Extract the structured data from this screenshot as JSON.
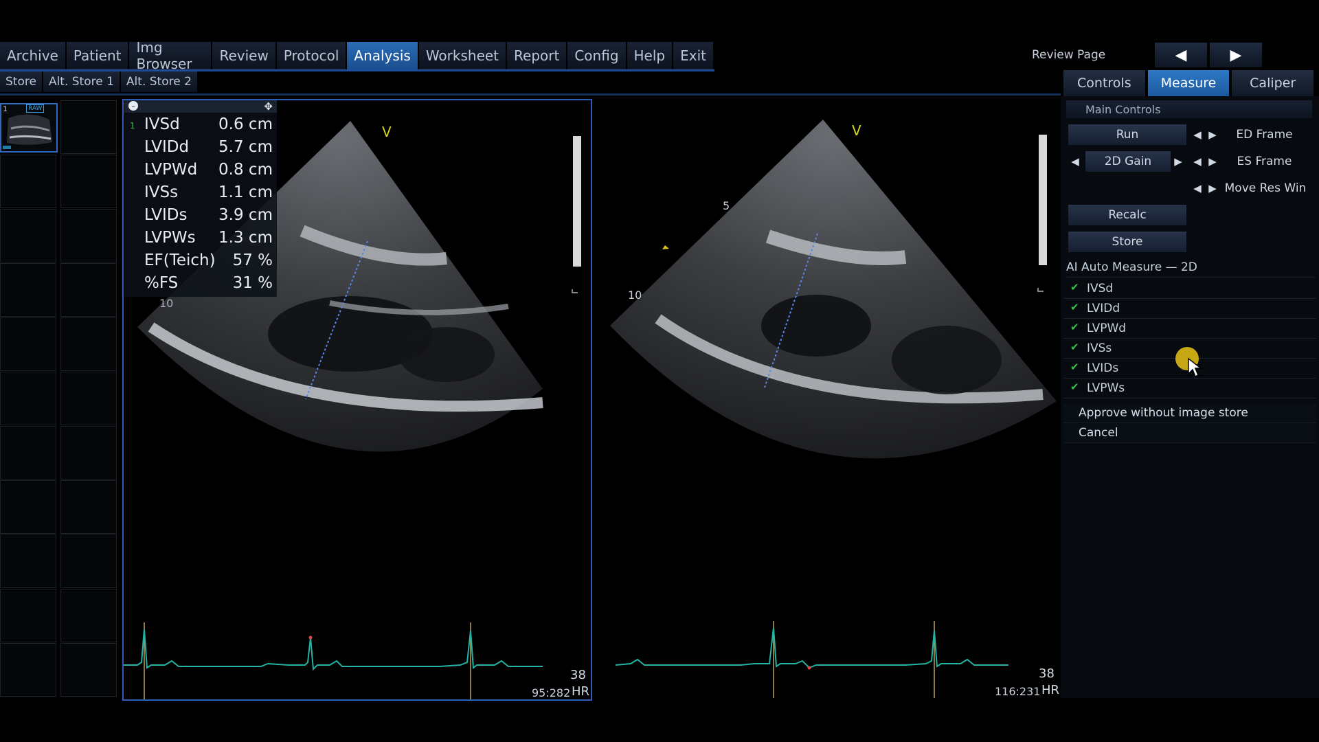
{
  "menu": {
    "items": [
      {
        "label": "Archive"
      },
      {
        "label": "Patient"
      },
      {
        "label": "Img Browser"
      },
      {
        "label": "Review"
      },
      {
        "label": "Protocol"
      },
      {
        "label": "Analysis"
      },
      {
        "label": "Worksheet"
      },
      {
        "label": "Report"
      },
      {
        "label": "Config"
      },
      {
        "label": "Help"
      },
      {
        "label": "Exit"
      }
    ],
    "active_index": 5
  },
  "review_page": {
    "label": "Review Page",
    "prev_icon": "triangle-left-icon",
    "next_icon": "triangle-right-icon"
  },
  "store_bar": {
    "items": [
      {
        "label": "Store"
      },
      {
        "label": "Alt. Store 1"
      },
      {
        "label": "Alt. Store 2"
      }
    ]
  },
  "tabs": {
    "items": [
      {
        "label": "Controls"
      },
      {
        "label": "Measure"
      },
      {
        "label": "Caliper"
      }
    ],
    "active_index": 1
  },
  "thumbnail": {
    "index_label": "1",
    "badge": "RAW"
  },
  "measurements": {
    "index": "1",
    "rows": [
      {
        "name": "IVSd",
        "value": "0.6 cm"
      },
      {
        "name": "LVIDd",
        "value": "5.7 cm"
      },
      {
        "name": "LVPWd",
        "value": "0.8 cm"
      },
      {
        "name": "IVSs",
        "value": "1.1 cm"
      },
      {
        "name": "LVIDs",
        "value": "3.9 cm"
      },
      {
        "name": "LVPWs",
        "value": "1.3 cm"
      },
      {
        "name": "EF(Teich)",
        "value": "57 %"
      },
      {
        "name": "%FS",
        "value": "31 %"
      }
    ]
  },
  "left_image": {
    "probe_marker": "V",
    "depth_label": "10",
    "hr_value": "38",
    "frame_info": "95:282",
    "hr_label": "HR"
  },
  "right_image": {
    "probe_marker": "V",
    "depth_5": "5",
    "depth_10": "10",
    "hr_value": "38",
    "frame_info": "116:231",
    "hr_label": "HR"
  },
  "main_controls": {
    "title": "Main Controls",
    "run": "Run",
    "gain": "2D Gain",
    "recalc": "Recalc",
    "store": "Store",
    "ed_frame": "ED Frame",
    "es_frame": "ES Frame",
    "move_res_win": "Move Res Win"
  },
  "ai_measure": {
    "title": "AI Auto Measure — 2D",
    "items": [
      {
        "label": "IVSd",
        "checked": true
      },
      {
        "label": "LVIDd",
        "checked": true
      },
      {
        "label": "LVPWd",
        "checked": true
      },
      {
        "label": "IVSs",
        "checked": true
      },
      {
        "label": "LVIDs",
        "checked": true
      },
      {
        "label": "LVPWs",
        "checked": true
      }
    ],
    "approve": "Approve without image store",
    "cancel": "Cancel"
  },
  "colors": {
    "accent": "#2e78c6",
    "ecg": "#22b3a4",
    "check": "#33c24a",
    "caliper": "#5a86e8"
  }
}
